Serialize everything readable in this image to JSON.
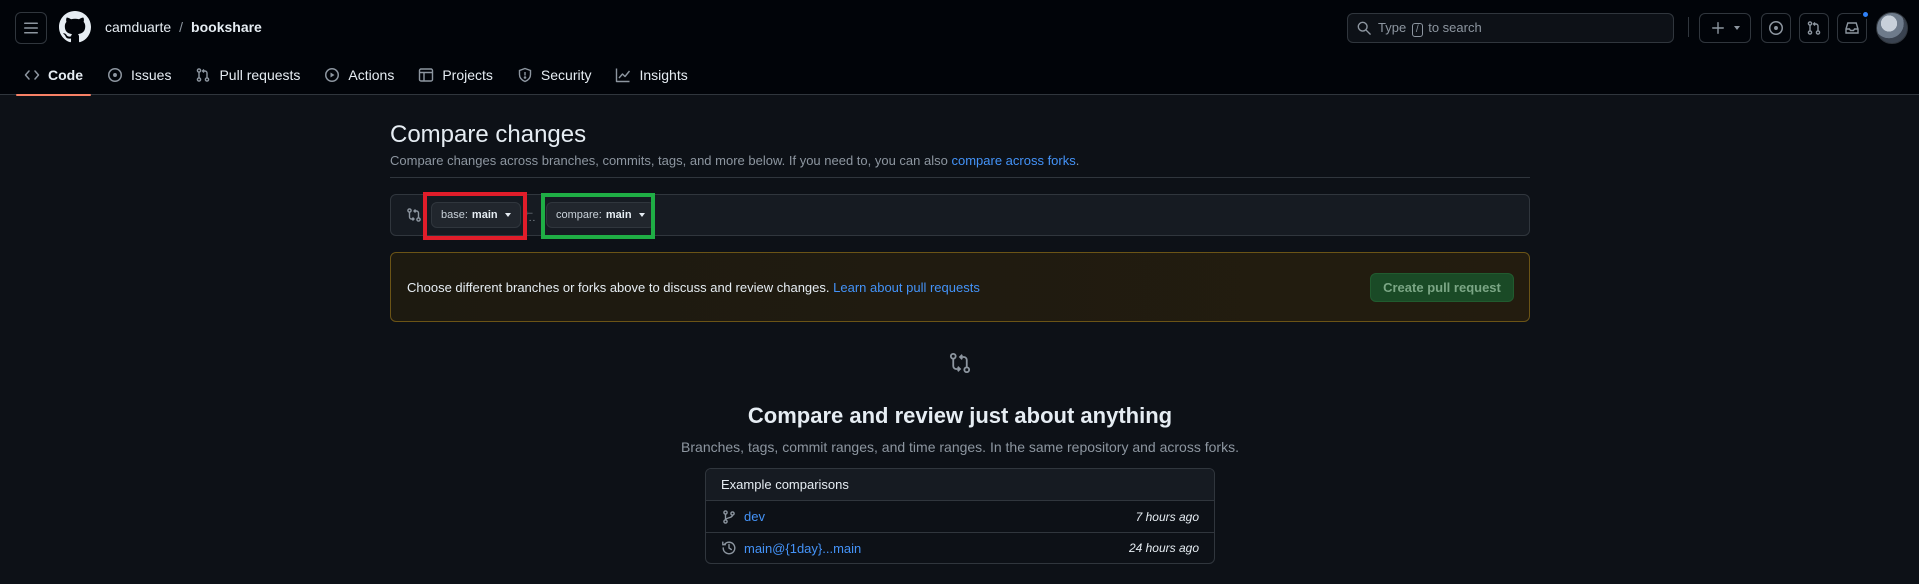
{
  "header": {
    "owner": "camduarte",
    "separator": "/",
    "repo": "bookshare",
    "search": {
      "prefix": "Type",
      "key": "/",
      "suffix": "to search"
    },
    "inbox_unread": true
  },
  "nav": {
    "tabs": [
      {
        "label": "Code",
        "icon": "code-icon",
        "selected": true
      },
      {
        "label": "Issues",
        "icon": "issue-opened-icon"
      },
      {
        "label": "Pull requests",
        "icon": "git-pull-request-icon"
      },
      {
        "label": "Actions",
        "icon": "play-icon"
      },
      {
        "label": "Projects",
        "icon": "table-icon"
      },
      {
        "label": "Security",
        "icon": "shield-icon"
      },
      {
        "label": "Insights",
        "icon": "graph-icon"
      }
    ]
  },
  "compare": {
    "title": "Compare changes",
    "subtitle": "Compare changes across branches, commits, tags, and more below. If you need to, you can also",
    "subtitle_link": "compare across forks",
    "subtitle_end": ".",
    "base": {
      "prefix": "base:",
      "branch": "main"
    },
    "head": {
      "prefix": "compare:",
      "branch": "main"
    },
    "arrow": "←",
    "dots": "...",
    "flash": {
      "text": "Choose different branches or forks above to discuss and review changes.",
      "link": "Learn about pull requests",
      "button": "Create pull request"
    },
    "blankslate": {
      "title": "Compare and review just about anything",
      "subtitle": "Branches, tags, commit ranges, and time ranges. In the same repository and across forks."
    },
    "examples": {
      "heading": "Example comparisons",
      "rows": [
        {
          "icon": "git-branch-icon",
          "label": "dev",
          "time": "7 hours ago"
        },
        {
          "icon": "history-icon",
          "label": "main@{1day}...main",
          "time": "24 hours ago"
        }
      ]
    }
  },
  "colors": {
    "accent": "#4493f8",
    "tab_underline": "#f78166",
    "highlight_base": "#e11d2a",
    "highlight_compare": "#1fae45"
  }
}
